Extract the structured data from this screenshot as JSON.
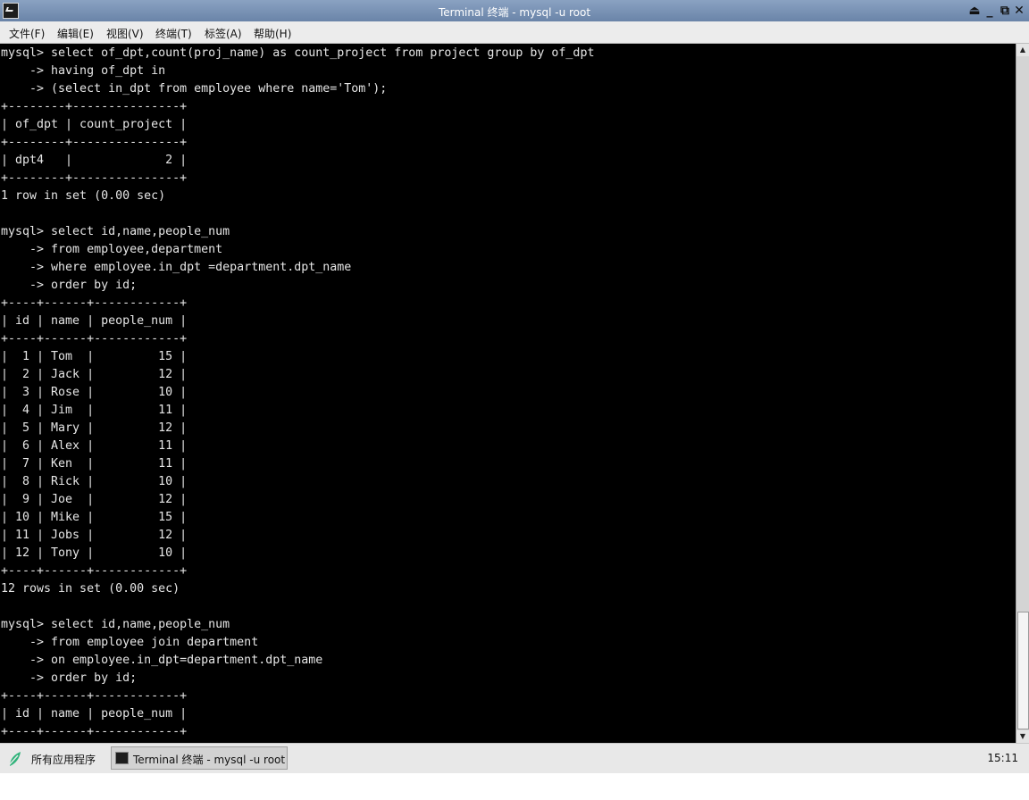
{
  "window": {
    "title": "Terminal 终端 - mysql -u root"
  },
  "menu": {
    "items": [
      "文件(F)",
      "编辑(E)",
      "视图(V)",
      "终端(T)",
      "标签(A)",
      "帮助(H)"
    ]
  },
  "terminal": {
    "lines": [
      "mysql> select of_dpt,count(proj_name) as count_project from project group by of_dpt",
      "    -> having of_dpt in",
      "    -> (select in_dpt from employee where name='Tom');",
      "+--------+---------------+",
      "| of_dpt | count_project |",
      "+--------+---------------+",
      "| dpt4   |             2 |",
      "+--------+---------------+",
      "1 row in set (0.00 sec)",
      "",
      "mysql> select id,name,people_num",
      "    -> from employee,department",
      "    -> where employee.in_dpt =department.dpt_name",
      "    -> order by id;",
      "+----+------+------------+",
      "| id | name | people_num |",
      "+----+------+------------+",
      "|  1 | Tom  |         15 |",
      "|  2 | Jack |         12 |",
      "|  3 | Rose |         10 |",
      "|  4 | Jim  |         11 |",
      "|  5 | Mary |         12 |",
      "|  6 | Alex |         11 |",
      "|  7 | Ken  |         11 |",
      "|  8 | Rick |         10 |",
      "|  9 | Joe  |         12 |",
      "| 10 | Mike |         15 |",
      "| 11 | Jobs |         12 |",
      "| 12 | Tony |         10 |",
      "+----+------+------------+",
      "12 rows in set (0.00 sec)",
      "",
      "mysql> select id,name,people_num",
      "    -> from employee join department",
      "    -> on employee.in_dpt=department.dpt_name",
      "    -> order by id;",
      "+----+------+------------+",
      "| id | name | people_num |",
      "+----+------+------------+"
    ]
  },
  "taskbar": {
    "start_label": "所有应用程序",
    "task_label": "Terminal 终端 - mysql -u root",
    "clock": "15:11"
  },
  "icons": {
    "app": "terminal-icon",
    "start": "leaf-icon",
    "window_buttons": [
      "eject-icon",
      "minimize-icon",
      "maximize-icon",
      "close-icon"
    ]
  },
  "colors": {
    "titlebar": "#7a93b6",
    "terminal_bg": "#000000",
    "terminal_fg": "#e6e6e6",
    "start_green": "#2fb37a"
  }
}
